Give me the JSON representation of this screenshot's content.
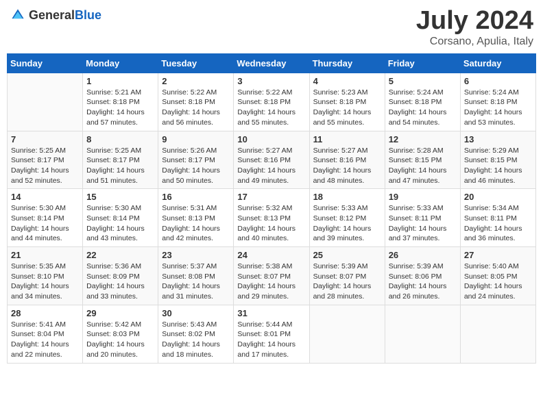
{
  "header": {
    "logo_general": "General",
    "logo_blue": "Blue",
    "month": "July 2024",
    "location": "Corsano, Apulia, Italy"
  },
  "weekdays": [
    "Sunday",
    "Monday",
    "Tuesday",
    "Wednesday",
    "Thursday",
    "Friday",
    "Saturday"
  ],
  "weeks": [
    [
      {
        "day": "",
        "sunrise": "",
        "sunset": "",
        "daylight": ""
      },
      {
        "day": "1",
        "sunrise": "Sunrise: 5:21 AM",
        "sunset": "Sunset: 8:18 PM",
        "daylight": "Daylight: 14 hours and 57 minutes."
      },
      {
        "day": "2",
        "sunrise": "Sunrise: 5:22 AM",
        "sunset": "Sunset: 8:18 PM",
        "daylight": "Daylight: 14 hours and 56 minutes."
      },
      {
        "day": "3",
        "sunrise": "Sunrise: 5:22 AM",
        "sunset": "Sunset: 8:18 PM",
        "daylight": "Daylight: 14 hours and 55 minutes."
      },
      {
        "day": "4",
        "sunrise": "Sunrise: 5:23 AM",
        "sunset": "Sunset: 8:18 PM",
        "daylight": "Daylight: 14 hours and 55 minutes."
      },
      {
        "day": "5",
        "sunrise": "Sunrise: 5:24 AM",
        "sunset": "Sunset: 8:18 PM",
        "daylight": "Daylight: 14 hours and 54 minutes."
      },
      {
        "day": "6",
        "sunrise": "Sunrise: 5:24 AM",
        "sunset": "Sunset: 8:18 PM",
        "daylight": "Daylight: 14 hours and 53 minutes."
      }
    ],
    [
      {
        "day": "7",
        "sunrise": "Sunrise: 5:25 AM",
        "sunset": "Sunset: 8:17 PM",
        "daylight": "Daylight: 14 hours and 52 minutes."
      },
      {
        "day": "8",
        "sunrise": "Sunrise: 5:25 AM",
        "sunset": "Sunset: 8:17 PM",
        "daylight": "Daylight: 14 hours and 51 minutes."
      },
      {
        "day": "9",
        "sunrise": "Sunrise: 5:26 AM",
        "sunset": "Sunset: 8:17 PM",
        "daylight": "Daylight: 14 hours and 50 minutes."
      },
      {
        "day": "10",
        "sunrise": "Sunrise: 5:27 AM",
        "sunset": "Sunset: 8:16 PM",
        "daylight": "Daylight: 14 hours and 49 minutes."
      },
      {
        "day": "11",
        "sunrise": "Sunrise: 5:27 AM",
        "sunset": "Sunset: 8:16 PM",
        "daylight": "Daylight: 14 hours and 48 minutes."
      },
      {
        "day": "12",
        "sunrise": "Sunrise: 5:28 AM",
        "sunset": "Sunset: 8:15 PM",
        "daylight": "Daylight: 14 hours and 47 minutes."
      },
      {
        "day": "13",
        "sunrise": "Sunrise: 5:29 AM",
        "sunset": "Sunset: 8:15 PM",
        "daylight": "Daylight: 14 hours and 46 minutes."
      }
    ],
    [
      {
        "day": "14",
        "sunrise": "Sunrise: 5:30 AM",
        "sunset": "Sunset: 8:14 PM",
        "daylight": "Daylight: 14 hours and 44 minutes."
      },
      {
        "day": "15",
        "sunrise": "Sunrise: 5:30 AM",
        "sunset": "Sunset: 8:14 PM",
        "daylight": "Daylight: 14 hours and 43 minutes."
      },
      {
        "day": "16",
        "sunrise": "Sunrise: 5:31 AM",
        "sunset": "Sunset: 8:13 PM",
        "daylight": "Daylight: 14 hours and 42 minutes."
      },
      {
        "day": "17",
        "sunrise": "Sunrise: 5:32 AM",
        "sunset": "Sunset: 8:13 PM",
        "daylight": "Daylight: 14 hours and 40 minutes."
      },
      {
        "day": "18",
        "sunrise": "Sunrise: 5:33 AM",
        "sunset": "Sunset: 8:12 PM",
        "daylight": "Daylight: 14 hours and 39 minutes."
      },
      {
        "day": "19",
        "sunrise": "Sunrise: 5:33 AM",
        "sunset": "Sunset: 8:11 PM",
        "daylight": "Daylight: 14 hours and 37 minutes."
      },
      {
        "day": "20",
        "sunrise": "Sunrise: 5:34 AM",
        "sunset": "Sunset: 8:11 PM",
        "daylight": "Daylight: 14 hours and 36 minutes."
      }
    ],
    [
      {
        "day": "21",
        "sunrise": "Sunrise: 5:35 AM",
        "sunset": "Sunset: 8:10 PM",
        "daylight": "Daylight: 14 hours and 34 minutes."
      },
      {
        "day": "22",
        "sunrise": "Sunrise: 5:36 AM",
        "sunset": "Sunset: 8:09 PM",
        "daylight": "Daylight: 14 hours and 33 minutes."
      },
      {
        "day": "23",
        "sunrise": "Sunrise: 5:37 AM",
        "sunset": "Sunset: 8:08 PM",
        "daylight": "Daylight: 14 hours and 31 minutes."
      },
      {
        "day": "24",
        "sunrise": "Sunrise: 5:38 AM",
        "sunset": "Sunset: 8:07 PM",
        "daylight": "Daylight: 14 hours and 29 minutes."
      },
      {
        "day": "25",
        "sunrise": "Sunrise: 5:39 AM",
        "sunset": "Sunset: 8:07 PM",
        "daylight": "Daylight: 14 hours and 28 minutes."
      },
      {
        "day": "26",
        "sunrise": "Sunrise: 5:39 AM",
        "sunset": "Sunset: 8:06 PM",
        "daylight": "Daylight: 14 hours and 26 minutes."
      },
      {
        "day": "27",
        "sunrise": "Sunrise: 5:40 AM",
        "sunset": "Sunset: 8:05 PM",
        "daylight": "Daylight: 14 hours and 24 minutes."
      }
    ],
    [
      {
        "day": "28",
        "sunrise": "Sunrise: 5:41 AM",
        "sunset": "Sunset: 8:04 PM",
        "daylight": "Daylight: 14 hours and 22 minutes."
      },
      {
        "day": "29",
        "sunrise": "Sunrise: 5:42 AM",
        "sunset": "Sunset: 8:03 PM",
        "daylight": "Daylight: 14 hours and 20 minutes."
      },
      {
        "day": "30",
        "sunrise": "Sunrise: 5:43 AM",
        "sunset": "Sunset: 8:02 PM",
        "daylight": "Daylight: 14 hours and 18 minutes."
      },
      {
        "day": "31",
        "sunrise": "Sunrise: 5:44 AM",
        "sunset": "Sunset: 8:01 PM",
        "daylight": "Daylight: 14 hours and 17 minutes."
      },
      {
        "day": "",
        "sunrise": "",
        "sunset": "",
        "daylight": ""
      },
      {
        "day": "",
        "sunrise": "",
        "sunset": "",
        "daylight": ""
      },
      {
        "day": "",
        "sunrise": "",
        "sunset": "",
        "daylight": ""
      }
    ]
  ]
}
